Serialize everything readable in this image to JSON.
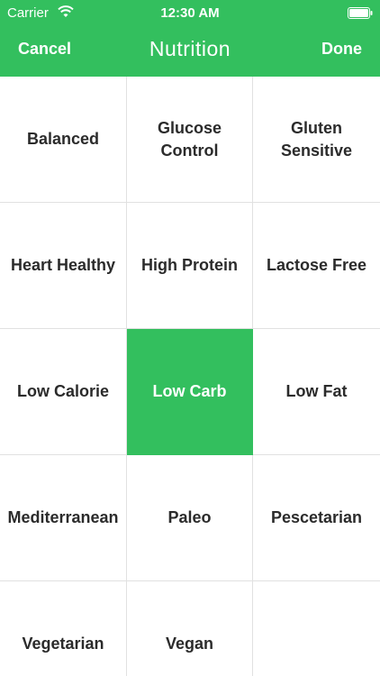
{
  "status_bar": {
    "carrier": "Carrier",
    "time": "12:30 AM",
    "wifi_icon": "wifi-icon",
    "battery_icon": "battery-icon"
  },
  "nav": {
    "cancel_label": "Cancel",
    "title": "Nutrition",
    "done_label": "Done"
  },
  "colors": {
    "accent": "#33bf5e",
    "text": "#2b2b2b",
    "divider": "#e1e1e1"
  },
  "options": [
    {
      "label": "Balanced",
      "selected": false
    },
    {
      "label": "Glucose\nControl",
      "selected": false
    },
    {
      "label": "Gluten\nSensitive",
      "selected": false
    },
    {
      "label": "Heart Healthy",
      "selected": false
    },
    {
      "label": "High Protein",
      "selected": false
    },
    {
      "label": "Lactose Free",
      "selected": false
    },
    {
      "label": "Low Calorie",
      "selected": false
    },
    {
      "label": "Low Carb",
      "selected": true
    },
    {
      "label": "Low Fat",
      "selected": false
    },
    {
      "label": "Mediterranean",
      "selected": false
    },
    {
      "label": "Paleo",
      "selected": false
    },
    {
      "label": "Pescetarian",
      "selected": false
    },
    {
      "label": "Vegetarian",
      "selected": false
    },
    {
      "label": "Vegan",
      "selected": false
    },
    {
      "label": "",
      "selected": false
    }
  ]
}
